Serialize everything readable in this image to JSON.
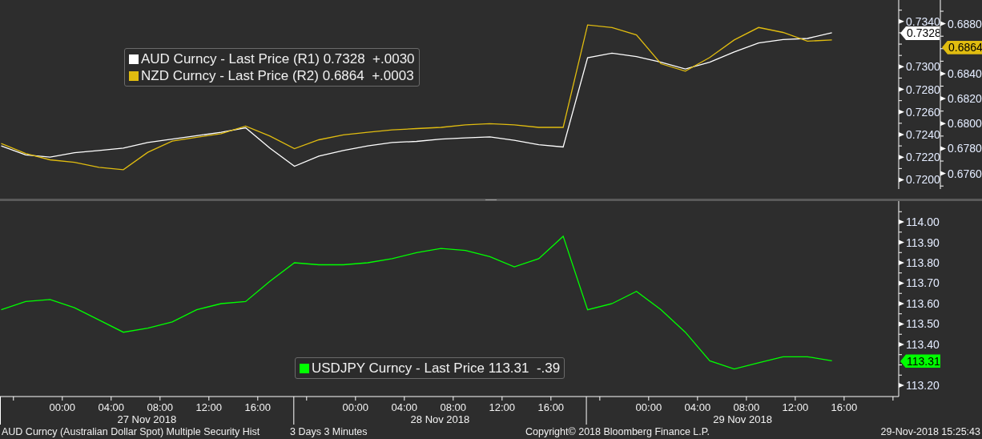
{
  "top_chart": {
    "legend": [
      {
        "label": "AUD Curncy - Last Price (R1) 0.7328  +.0030",
        "color": "#ffffff"
      },
      {
        "label": "NZD Curncy - Last Price (R2) 0.6864  +.0003",
        "color": "#e0bc10"
      }
    ],
    "panes": [
      {
        "price_tag": {
          "text": "0.7328",
          "color": "#ffffff"
        },
        "axis_labels": [
          "0.7340",
          "0.7300",
          "0.7280",
          "0.7260",
          "0.7240",
          "0.7220",
          "0.7200"
        ]
      },
      {
        "price_tag": {
          "text": "0.6864",
          "color": "#e0bc10"
        },
        "axis_labels": [
          "0.6880",
          "0.6840",
          "0.6820",
          "0.6800",
          "0.6780",
          "0.6760"
        ]
      }
    ]
  },
  "bottom_chart": {
    "legend": [
      {
        "label": "USDJPY Curncy - Last Price 113.31  -.39",
        "color": "#00ff00"
      }
    ],
    "price_tag": {
      "text": "113.31",
      "color": "#00ff00"
    },
    "chart_data": {
      "type": "line",
      "xlim": [
        "2018-11-26T18:54",
        "2018-11-29T20:28"
      ],
      "ylim": [
        113.145,
        114.102
      ],
      "yticks": [
        {
          "value": 113.2,
          "label": "113.20"
        },
        {
          "value": 113.4,
          "label": "113.40"
        },
        {
          "value": 113.5,
          "label": "113.50"
        },
        {
          "value": 113.6,
          "label": "113.60"
        },
        {
          "value": 113.7,
          "label": "113.70"
        },
        {
          "value": 113.8,
          "label": "113.80"
        },
        {
          "value": 113.9,
          "label": "113.90"
        },
        {
          "value": 114,
          "label": "114.00"
        }
      ],
      "xticks": [
        {
          "value": "2018-11-27T00:00",
          "label": "00:00"
        },
        {
          "value": "2018-11-27T04:00",
          "label": "04:00"
        },
        {
          "value": "2018-11-27T08:00",
          "label": "08:00"
        },
        {
          "value": "2018-11-27T12:00",
          "label": "12:00"
        },
        {
          "value": "2018-11-27T16:00",
          "label": "16:00"
        },
        {
          "value": "2018-11-28T00:00",
          "label": "00:00"
        },
        {
          "value": "2018-11-28T04:00",
          "label": "04:00"
        },
        {
          "value": "2018-11-28T08:00",
          "label": "08:00"
        },
        {
          "value": "2018-11-28T12:00",
          "label": "12:00"
        },
        {
          "value": "2018-11-28T16:00",
          "label": "16:00"
        },
        {
          "value": "2018-11-29T00:00",
          "label": "00:00"
        },
        {
          "value": "2018-11-29T04:00",
          "label": "04:00"
        },
        {
          "value": "2018-11-29T08:00",
          "label": "08:00"
        },
        {
          "value": "2018-11-29T12:00",
          "label": "12:00"
        },
        {
          "value": "2018-11-29T16:00",
          "label": "16:00"
        }
      ],
      "x": [
        "2018-11-26T19:00",
        "2018-11-26T21:00",
        "2018-11-26T23:00",
        "2018-11-27T01:00",
        "2018-11-27T03:00",
        "2018-11-27T05:00",
        "2018-11-27T07:00",
        "2018-11-27T09:00",
        "2018-11-27T11:00",
        "2018-11-27T13:00",
        "2018-11-27T15:00",
        "2018-11-27T17:00",
        "2018-11-27T19:00",
        "2018-11-27T21:00",
        "2018-11-27T23:00",
        "2018-11-28T01:00",
        "2018-11-28T03:00",
        "2018-11-28T05:00",
        "2018-11-28T07:00",
        "2018-11-28T09:00",
        "2018-11-28T11:00",
        "2018-11-28T13:00",
        "2018-11-28T15:00",
        "2018-11-28T17:00",
        "2018-11-28T19:00",
        "2018-11-28T21:00",
        "2018-11-28T23:00",
        "2018-11-29T01:00",
        "2018-11-29T03:00",
        "2018-11-29T05:00",
        "2018-11-29T07:00",
        "2018-11-29T09:00",
        "2018-11-29T11:00",
        "2018-11-29T13:00",
        "2018-11-29T15:00"
      ],
      "series": [
        {
          "color": "#00ff00",
          "values": [
            113.57,
            113.61,
            113.62,
            113.58,
            113.52,
            113.46,
            113.48,
            113.51,
            113.57,
            113.6,
            113.61,
            113.71,
            113.8,
            113.79,
            113.79,
            113.8,
            113.82,
            113.85,
            113.87,
            113.86,
            113.83,
            113.78,
            113.82,
            113.93,
            113.57,
            113.6,
            113.66,
            113.57,
            113.46,
            113.32,
            113.28,
            113.31,
            113.34,
            113.34,
            113.32
          ]
        }
      ]
    }
  },
  "date_labels": [
    "27 Nov 2018",
    "28 Nov 2018",
    "29 Nov 2018"
  ],
  "status_bar": {
    "description": "AUD Curncy (Australian Dollar Spot) Multiple Security Hist",
    "range": "3 Days 3 Minutes",
    "copyright": "Copyright© 2018 Bloomberg Finance L.P.",
    "timestamp": "29-Nov-2018 15:25:43"
  }
}
